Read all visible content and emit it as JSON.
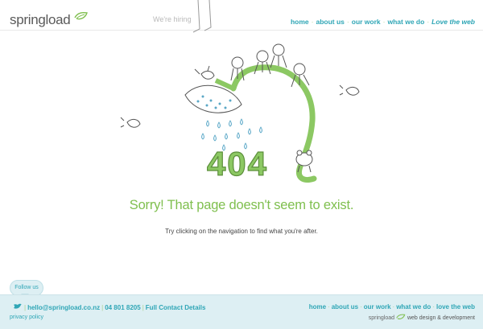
{
  "header": {
    "logo_text": "springload",
    "hiring": "We're hiring",
    "nav": [
      {
        "label": "home"
      },
      {
        "label": "about us"
      },
      {
        "label": "our work"
      },
      {
        "label": "what we do"
      },
      {
        "label": "Love the web"
      }
    ]
  },
  "illustration": {
    "error_code": "404"
  },
  "content": {
    "headline": "Sorry! That page doesn't seem to exist.",
    "hint": "Try clicking on the navigation to find what you're after."
  },
  "footer": {
    "follow_label": "Follow us",
    "email": "hello@springload.co.nz",
    "phone": "04 801 8205",
    "contact_link": "Full Contact Details",
    "privacy": "privacy policy",
    "nav": [
      {
        "label": "home"
      },
      {
        "label": "about us"
      },
      {
        "label": "our work"
      },
      {
        "label": "what we do"
      },
      {
        "label": "love the web"
      }
    ],
    "brand_name": "springload",
    "tagline": "web design & development"
  },
  "colors": {
    "accent_green": "#7fbf4e",
    "link_teal": "#2fa6b6",
    "footer_bg": "#ddeff3"
  }
}
